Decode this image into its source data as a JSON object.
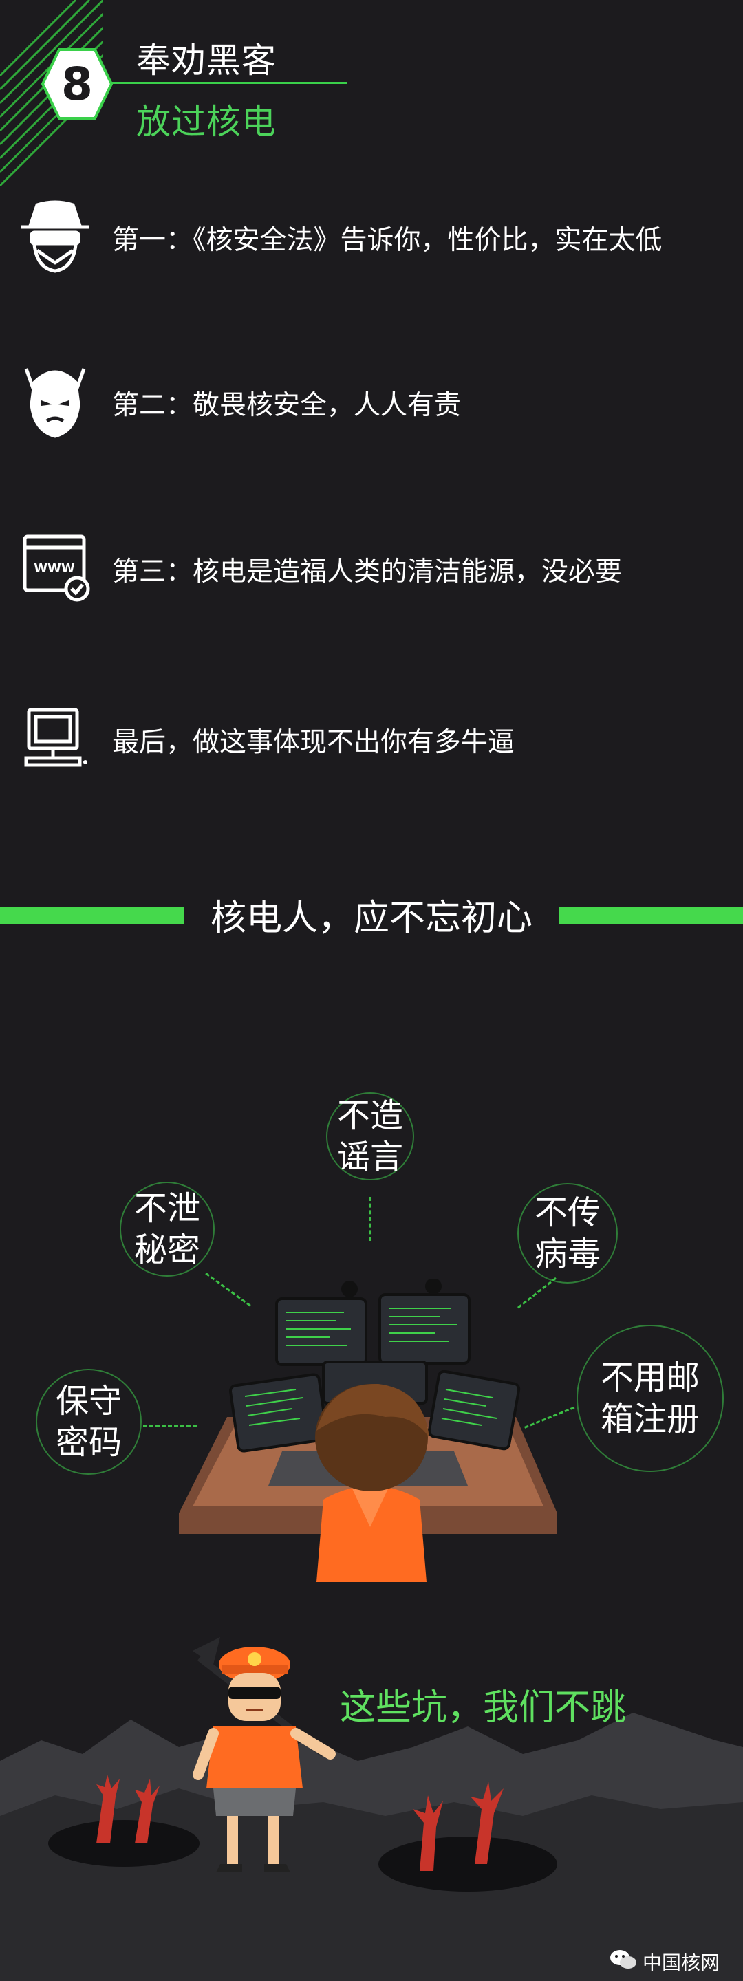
{
  "header": {
    "number": "8",
    "title_line1": "奉劝黑客",
    "title_line2": "放过核电"
  },
  "rules": [
    {
      "icon": "spy-hacker-icon",
      "text": "第一：《核安全法》告诉你，性价比，实在太低"
    },
    {
      "icon": "masked-face-icon",
      "text": "第二：敬畏核安全，人人有责"
    },
    {
      "icon": "web-browser-check-icon",
      "text": "第三：核电是造福人类的清洁能源，没必要"
    },
    {
      "icon": "computer-monitor-icon",
      "text": "最后，做这事体现不出你有多牛逼"
    }
  ],
  "divider": {
    "title": "核电人，应不忘初心"
  },
  "bubbles": {
    "top": [
      "不造",
      "谣言"
    ],
    "left_upper": [
      "不泄",
      "秘密"
    ],
    "right_upper": [
      "不传",
      "病毒"
    ],
    "left_lower": [
      "保守",
      "密码"
    ],
    "right_lower": [
      "不用邮",
      "箱注册"
    ]
  },
  "slogan": "这些坑，我们不跳",
  "watermark": "中国核网",
  "colors": {
    "background": "#1c1b1e",
    "accent_green": "#45d94c",
    "text": "#ffffff"
  }
}
